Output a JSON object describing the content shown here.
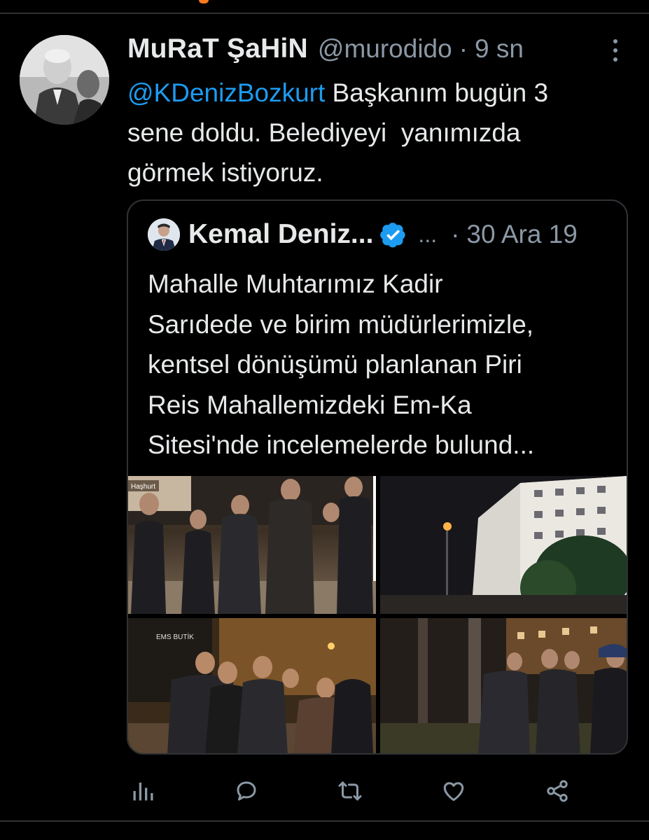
{
  "tweet": {
    "display_name": "MuRaT ŞaHiN",
    "handle": "@murodido",
    "separator": "·",
    "time": "9 sn",
    "mention": "@KDenizBozkurt",
    "text_line1": " Başkanım bugün 3",
    "text_line2": "sene doldu. Belediyeyi  yanımızda",
    "text_line3": "görmek istiyoruz."
  },
  "quoted": {
    "display_name": "Kemal Deniz...",
    "ellipsis": "...",
    "separator": "·",
    "time": "30 Ara 19",
    "lines": [
      "Mahalle Muhtarımız Kadir",
      "Sarıdede ve birim müdürlerimizle,",
      "kentsel dönüşümü planlanan Piri",
      "Reis Mahallemizdeki Em-Ka",
      "Sitesi'nde incelemelerde bulund..."
    ],
    "photo_captions": [
      "Haşhurt",
      "EMS BUTİK"
    ]
  },
  "actions": [
    "analytics-icon",
    "reply-icon",
    "retweet-icon",
    "like-icon",
    "share-icon"
  ],
  "colors": {
    "background": "#000000",
    "text": "#e7e9ea",
    "secondary": "#8b98a5",
    "accent": "#1d9bf0",
    "border": "#2f3336"
  }
}
